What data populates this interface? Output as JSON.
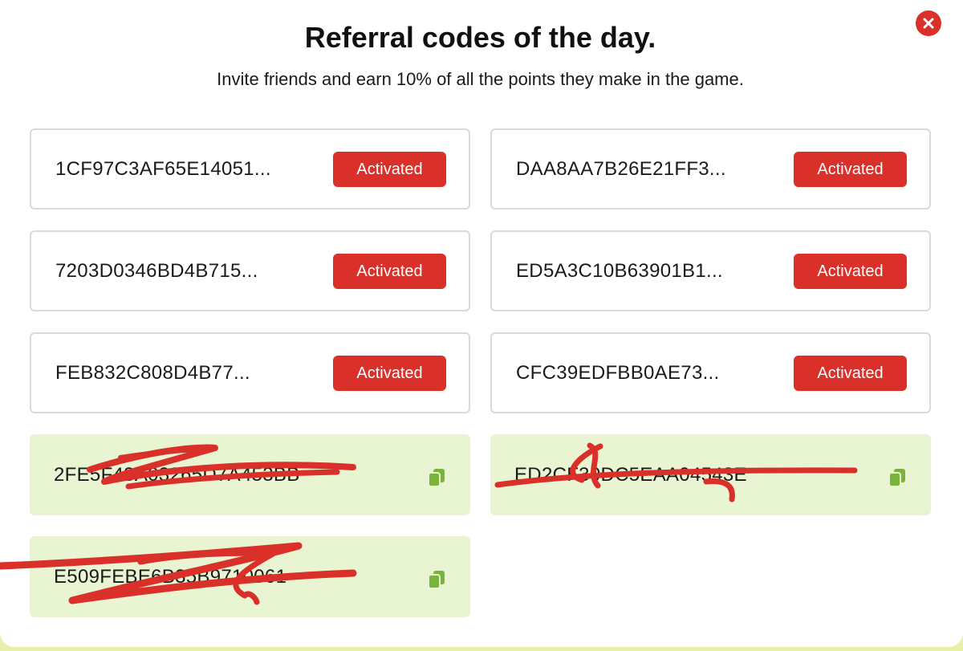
{
  "dialog": {
    "title": "Referral codes of the day.",
    "subtitle": "Invite friends and earn 10% of all the points they make in the game.",
    "close_icon": "close-icon"
  },
  "codes": [
    {
      "code": "1CF97C3AF65E14051...",
      "status": "Activated"
    },
    {
      "code": "DAA8AA7B26E21FF3...",
      "status": "Activated"
    },
    {
      "code": "7203D0346BD4B715...",
      "status": "Activated"
    },
    {
      "code": "ED5A3C10B63901B1...",
      "status": "Activated"
    },
    {
      "code": "FEB832C808D4B77...",
      "status": "Activated"
    },
    {
      "code": "CFC39EDFBB0AE73...",
      "status": "Activated"
    },
    {
      "code": "2FE5F43A03265D7A453BB",
      "icon": "copy-icon"
    },
    {
      "code": "ED2CF30DC5EAA04543E",
      "icon": "copy-icon"
    },
    {
      "code": "E509FEBE6B35B9710061",
      "icon": "copy-icon"
    }
  ],
  "colors": {
    "accent_red": "#d9302a",
    "available_bg": "#e8f4d2",
    "copy_icon": "#7ab33a",
    "scribble": "#d9302a"
  }
}
